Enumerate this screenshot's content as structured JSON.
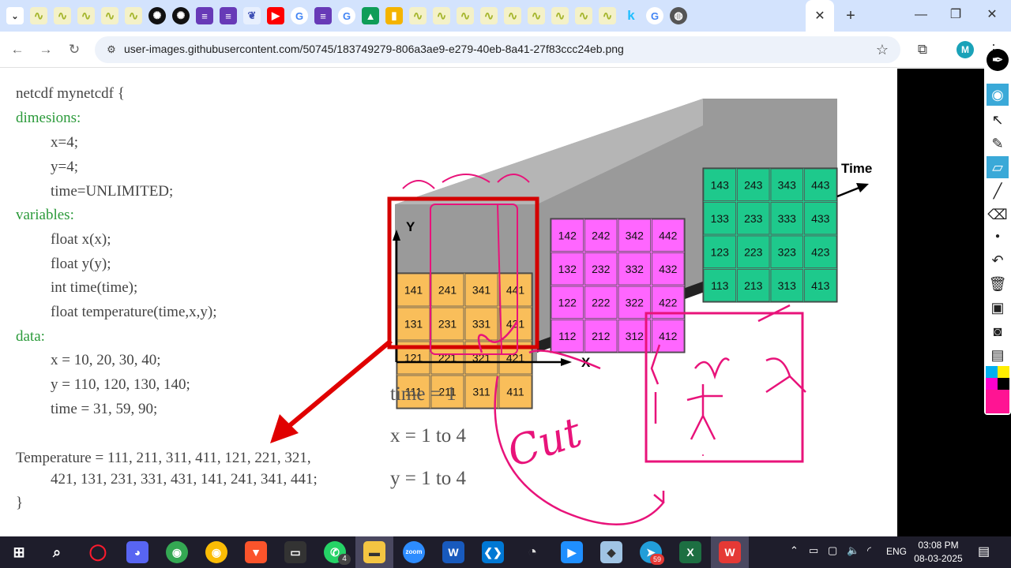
{
  "browser": {
    "url": "user-images.githubusercontent.com/50745/183749279-806a3ae9-e279-40eb-8a41-27f83ccc24eb.png",
    "active_tab_close": "✕",
    "new_tab": "+",
    "profile_initial": "M"
  },
  "code": {
    "line1": "netcdf mynetcdf {",
    "dimensions_kw": "dimesions:",
    "dim_x": "x=4;",
    "dim_y": "y=4;",
    "dim_time": "time=UNLIMITED;",
    "variables_kw": "variables:",
    "var1": "float x(x);",
    "var2": "float y(y);",
    "var3": "int time(time);",
    "var4": "float temperature(time,x,y);",
    "data_kw": "data:",
    "data_x": "x = 10, 20, 30, 40;",
    "data_y": "y = 110, 120, 130, 140;",
    "data_time": "time = 31, 59, 90;",
    "temp_line1": "Temperature = 111, 211, 311, 411, 121, 221, 321,",
    "temp_line2": "421, 131, 231, 331, 431, 141, 241, 341, 441;",
    "closing": "}"
  },
  "diagram": {
    "axis_y": "Y",
    "axis_x": "X",
    "axis_time": "Time",
    "front_grid": [
      [
        "141",
        "241",
        "341",
        "441"
      ],
      [
        "131",
        "231",
        "331",
        "431"
      ],
      [
        "121",
        "221",
        "321",
        "421"
      ],
      [
        "111",
        "211",
        "311",
        "411"
      ]
    ],
    "middle_grid": [
      [
        "142",
        "242",
        "342",
        "442"
      ],
      [
        "132",
        "232",
        "332",
        "432"
      ],
      [
        "122",
        "222",
        "322",
        "422"
      ],
      [
        "112",
        "212",
        "312",
        "412"
      ]
    ],
    "back_grid": [
      [
        "143",
        "243",
        "343",
        "443"
      ],
      [
        "133",
        "233",
        "333",
        "433"
      ],
      [
        "123",
        "223",
        "323",
        "423"
      ],
      [
        "113",
        "213",
        "313",
        "413"
      ]
    ],
    "colors": {
      "front": "#f9be5a",
      "middle": "#ff66ff",
      "back": "#1ec98c",
      "ink": "#e8137a",
      "highlight": "#d40000"
    }
  },
  "annotations": {
    "time": "time = 1",
    "x": "x = 1 to 4",
    "y": "y = 1 to 4",
    "handwriting": "Cut"
  },
  "taskbar": {
    "time": "03:08 PM",
    "date": "08-03-2025",
    "lang": "ENG",
    "whatsapp_badge": "4",
    "telegram_badge": "59"
  }
}
